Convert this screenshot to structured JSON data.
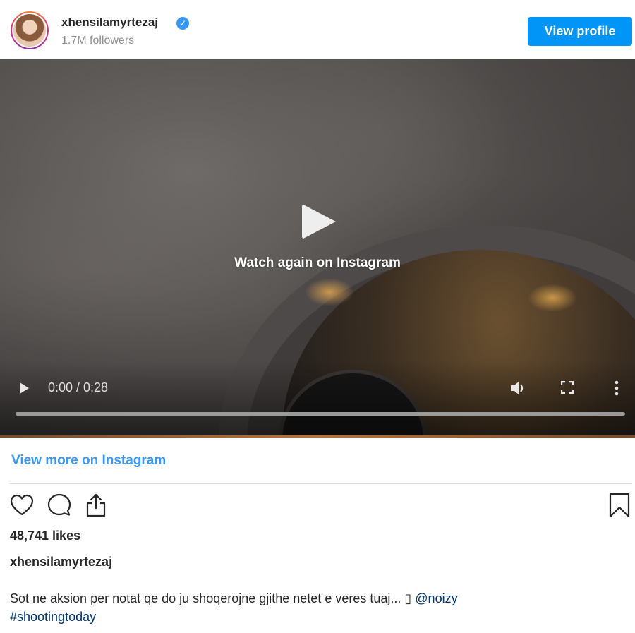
{
  "header": {
    "username": "xhensilamyrtezaj",
    "followers": "1.7M followers",
    "view_profile_label": "View profile"
  },
  "video": {
    "overlay_text": "Watch again on Instagram",
    "time": "0:00 / 0:28",
    "progress_fraction": 0.0
  },
  "links": {
    "view_more": "View more on Instagram"
  },
  "post": {
    "likes": "48,741 likes",
    "caption_user": "xhensilamyrtezaj",
    "caption_text": "Sot ne aksion per notat qe do ju shoqerojne gjithe netet e veres tuaj... ▯ ",
    "mention": "@noizy",
    "hashtag": "#shootingtoday"
  },
  "icons": {
    "verified": "verified-badge-icon",
    "like": "heart-icon",
    "comment": "comment-bubble-icon",
    "share": "share-icon",
    "save": "bookmark-icon",
    "play": "play-icon",
    "volume": "volume-icon",
    "fullscreen": "fullscreen-icon",
    "more": "more-vertical-icon"
  },
  "colors": {
    "accent": "#0095f6",
    "link": "#3897f0",
    "mention": "#003569"
  }
}
